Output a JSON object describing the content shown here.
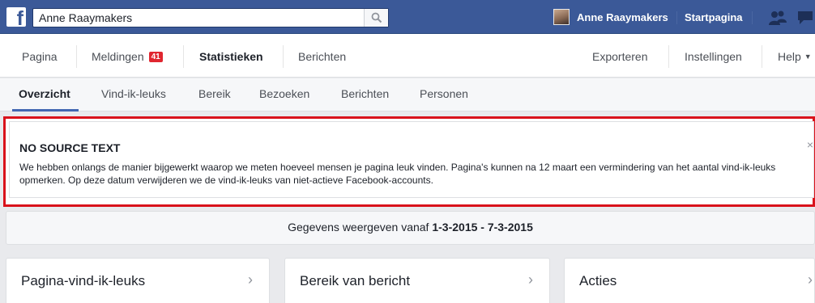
{
  "topbar": {
    "search_value": "Anne Raaymakers",
    "user_name": "Anne Raaymakers",
    "home_link": "Startpagina",
    "brand_color": "#3b5998"
  },
  "pagenav": {
    "items": [
      {
        "label": "Pagina"
      },
      {
        "label": "Meldingen",
        "badge": "41"
      },
      {
        "label": "Statistieken"
      },
      {
        "label": "Berichten"
      }
    ],
    "right_items": [
      {
        "label": "Exporteren"
      },
      {
        "label": "Instellingen"
      },
      {
        "label": "Help"
      }
    ]
  },
  "subtabs": [
    {
      "label": "Overzicht"
    },
    {
      "label": "Vind-ik-leuks"
    },
    {
      "label": "Bereik"
    },
    {
      "label": "Bezoeken"
    },
    {
      "label": "Berichten"
    },
    {
      "label": "Personen"
    }
  ],
  "notice": {
    "title": "NO SOURCE TEXT",
    "body": "We hebben onlangs de manier bijgewerkt waarop we meten hoeveel mensen je pagina leuk vinden. Pagina's kunnen na 12 maart een vermindering van het aantal vind-ik-leuks opmerken. Op deze datum verwijderen we de vind-ik-leuks van niet-actieve Facebook-accounts.",
    "highlight_color": "#d9121b"
  },
  "daterange": {
    "prefix": "Gegevens weergeven vanaf ",
    "range": "1-3-2015 - 7-3-2015"
  },
  "cards": [
    {
      "title": "Pagina-vind-ik-leuks"
    },
    {
      "title": "Bereik van bericht"
    },
    {
      "title": "Acties"
    }
  ],
  "icons": {
    "logo": "facebook-logo-icon",
    "search": "search-icon",
    "friends": "friends-icon",
    "messages": "messages-icon",
    "chevron": "chevron-right-icon",
    "close": "close-icon"
  }
}
